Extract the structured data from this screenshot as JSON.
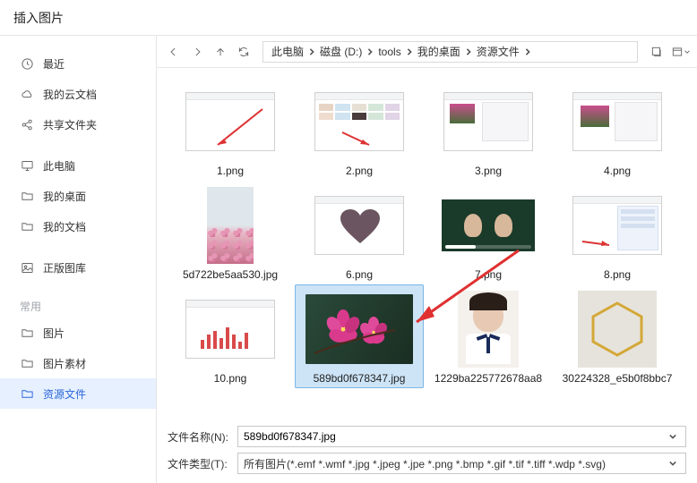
{
  "title": "插入图片",
  "sidebar": {
    "groups": [
      {
        "items": [
          {
            "label": "最近",
            "icon": "clock-icon"
          },
          {
            "label": "我的云文档",
            "icon": "cloud-icon"
          },
          {
            "label": "共享文件夹",
            "icon": "share-icon"
          }
        ]
      },
      {
        "items": [
          {
            "label": "此电脑",
            "icon": "monitor-icon"
          },
          {
            "label": "我的桌面",
            "icon": "folder-icon"
          },
          {
            "label": "我的文档",
            "icon": "folder-icon"
          }
        ]
      },
      {
        "items": [
          {
            "label": "正版图库",
            "icon": "image-icon"
          }
        ]
      }
    ],
    "frequent_heading": "常用",
    "frequent_items": [
      {
        "label": "图片",
        "icon": "folder-icon"
      },
      {
        "label": "图片素材",
        "icon": "folder-icon"
      },
      {
        "label": "资源文件",
        "icon": "folder-icon",
        "selected": true
      }
    ]
  },
  "breadcrumb": [
    "此电脑",
    "磁盘 (D:)",
    "tools",
    "我的桌面",
    "资源文件"
  ],
  "files": [
    {
      "name": "1.png",
      "thumb": "app1"
    },
    {
      "name": "2.png",
      "thumb": "app2"
    },
    {
      "name": "3.png",
      "thumb": "app3"
    },
    {
      "name": "4.png",
      "thumb": "app4"
    },
    {
      "name": "5d722be5aa530.jpg",
      "thumb": "blossom_tall"
    },
    {
      "name": "6.png",
      "thumb": "heart"
    },
    {
      "name": "7.png",
      "thumb": "video"
    },
    {
      "name": "8.png",
      "thumb": "chat"
    },
    {
      "name": "10.png",
      "thumb": "chart"
    },
    {
      "name": "589bd0f678347.jpg",
      "thumb": "plum",
      "selected": true
    },
    {
      "name": "1229ba225772678aa8",
      "thumb": "portrait"
    },
    {
      "name": "30224328_e5b0f8bbc7",
      "thumb": "hexagon"
    }
  ],
  "filename_label": "文件名称(N):",
  "filename_value": "589bd0f678347.jpg",
  "filetype_label": "文件类型(T):",
  "filetype_value": "所有图片(*.emf *.wmf *.jpg *.jpeg *.jpe *.png *.bmp *.gif *.tif *.tiff *.wdp *.svg)"
}
